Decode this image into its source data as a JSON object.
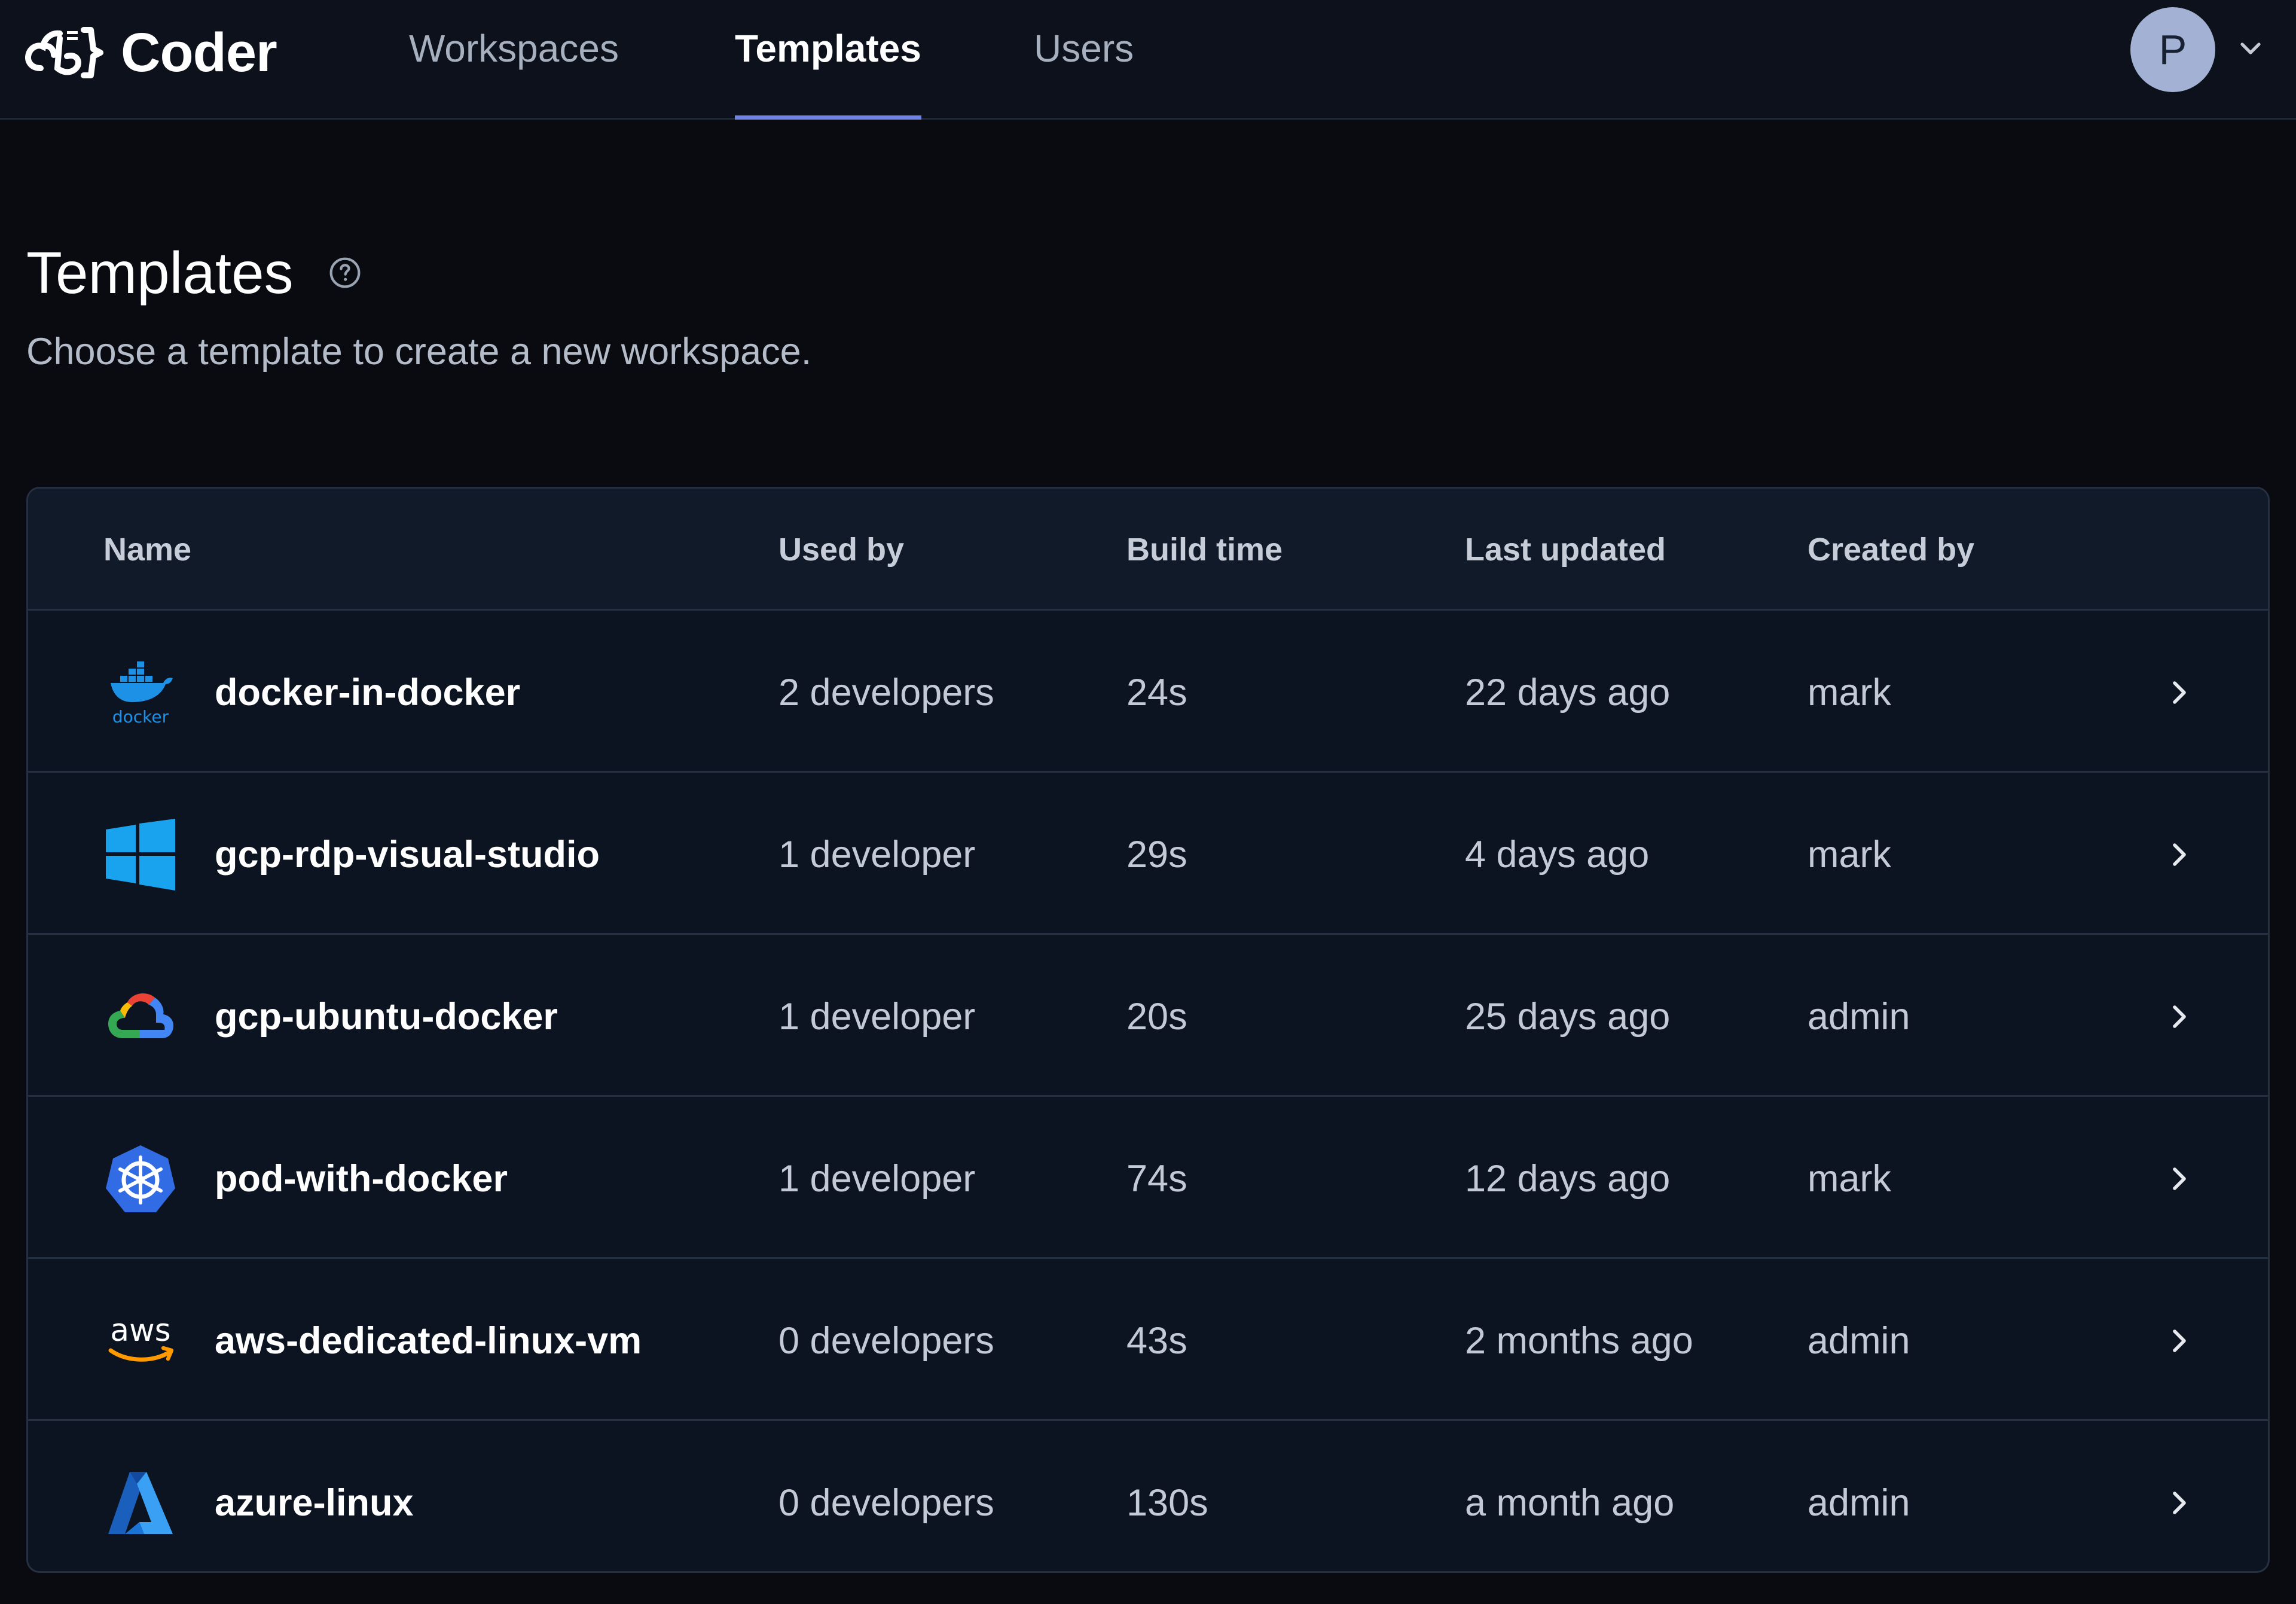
{
  "app": {
    "name": "Coder"
  },
  "nav": {
    "tabs": [
      {
        "label": "Workspaces",
        "active": false
      },
      {
        "label": "Templates",
        "active": true
      },
      {
        "label": "Users",
        "active": false
      }
    ],
    "user_initial": "P"
  },
  "page": {
    "title": "Templates",
    "subtitle": "Choose a template to create a new workspace."
  },
  "table": {
    "headers": {
      "name": "Name",
      "used_by": "Used by",
      "build_time": "Build time",
      "last_updated": "Last updated",
      "created_by": "Created by"
    },
    "rows": [
      {
        "icon": "docker-icon",
        "name": "docker-in-docker",
        "used_by": "2 developers",
        "build_time": "24s",
        "last_updated": "22 days ago",
        "created_by": "mark"
      },
      {
        "icon": "windows-icon",
        "name": "gcp-rdp-visual-studio",
        "used_by": "1 developer",
        "build_time": "29s",
        "last_updated": "4 days ago",
        "created_by": "mark"
      },
      {
        "icon": "google-cloud-icon",
        "name": "gcp-ubuntu-docker",
        "used_by": "1 developer",
        "build_time": "20s",
        "last_updated": "25 days ago",
        "created_by": "admin"
      },
      {
        "icon": "kubernetes-icon",
        "name": "pod-with-docker",
        "used_by": "1 developer",
        "build_time": "74s",
        "last_updated": "12 days ago",
        "created_by": "mark"
      },
      {
        "icon": "aws-icon",
        "name": "aws-dedicated-linux-vm",
        "used_by": "0 developers",
        "build_time": "43s",
        "last_updated": "2 months ago",
        "created_by": "admin"
      },
      {
        "icon": "azure-icon",
        "name": "azure-linux",
        "used_by": "0 developers",
        "build_time": "130s",
        "last_updated": "a month ago",
        "created_by": "admin"
      }
    ]
  },
  "colors": {
    "background": "#090b11",
    "topbar": "#0c111c",
    "accent": "#6e82e8",
    "table_bg": "#0d1421",
    "border": "#263043"
  }
}
